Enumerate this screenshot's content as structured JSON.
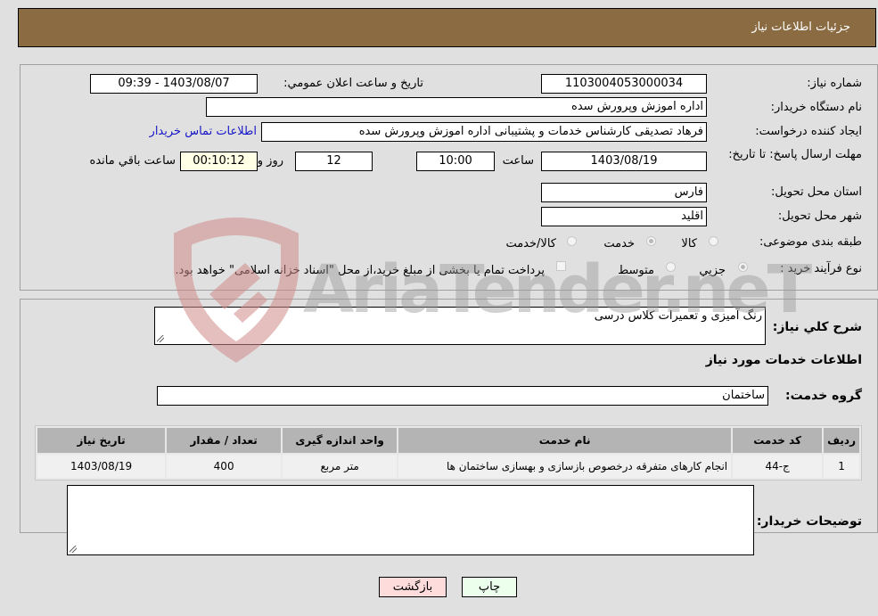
{
  "header": {
    "title": "جزئیات اطلاعات نیاز"
  },
  "need_info": {
    "need_number_label": "شماره نیاز:",
    "need_number": "1103004053000034",
    "announce_label": "تاریخ و ساعت اعلان عمومي:",
    "announce_value": "1403/08/07 - 09:39",
    "buyer_org_label": "نام دستگاه خریدار:",
    "buyer_org": "اداره اموزش وپرورش سده",
    "creator_label": "ایجاد کننده درخواست:",
    "creator": "فرهاد تصدیقی کارشناس خدمات و پشتیبانی اداره اموزش وپرورش سده",
    "contact_link": "اطلاعات تماس خریدار",
    "deadline_label": "مهلت ارسال پاسخ: تا تاریخ:",
    "deadline_date": "1403/08/19",
    "time_label": "ساعت",
    "deadline_time": "10:00",
    "days_value": "12",
    "days_label": "روز و",
    "remaining_value": "00:10:12",
    "remaining_label": "ساعت باقي مانده",
    "province_label": "استان محل تحویل:",
    "province": "فارس",
    "city_label": "شهر محل تحویل:",
    "city": "اقلید",
    "category_label": "طبقه بندی موضوعی:",
    "category_options": [
      {
        "label": "کالا",
        "selected": false
      },
      {
        "label": "خدمت",
        "selected": true
      },
      {
        "label": "کالا/خدمت",
        "selected": false
      }
    ],
    "process_label": "نوع فرآیند خرید :",
    "process_options": [
      {
        "label": "جزيي",
        "selected": true
      },
      {
        "label": "متوسط",
        "selected": false
      }
    ],
    "treasury_checkbox_label": "پرداخت تمام یا بخشی از مبلغ خرید،از محل \"اسناد خزانه اسلامی\" خواهد بود.",
    "treasury_checked": false
  },
  "details": {
    "description_label": "شرح کلي نیاز:",
    "description": "رنگ آمیزی و تعمیرات کلاس درسی",
    "services_heading": "اطلاعات خدمات مورد نیاز",
    "service_group_label": "گروه خدمت:",
    "service_group": "ساختمان",
    "table": {
      "headers": [
        "ردیف",
        "کد خدمت",
        "نام خدمت",
        "واحد اندازه گیری",
        "تعداد / مقدار",
        "تاریخ نیاز"
      ],
      "rows": [
        [
          "1",
          "ج-44",
          "انجام کارهای متفرقه درخصوص بازسازی و بهسازی ساختمان ها",
          "متر مربع",
          "400",
          "1403/08/19"
        ]
      ]
    },
    "buyer_notes_label": "توضیحات خریدار:",
    "buyer_notes": ""
  },
  "buttons": {
    "print": "چاپ",
    "back": "بازگشت"
  },
  "watermark": {
    "text": "AriaTender.neT"
  },
  "colors": {
    "header_bg": "#8b6b42",
    "link": "#1515c8",
    "back_bg": "#ffdcdc",
    "print_bg": "#ecffec"
  }
}
